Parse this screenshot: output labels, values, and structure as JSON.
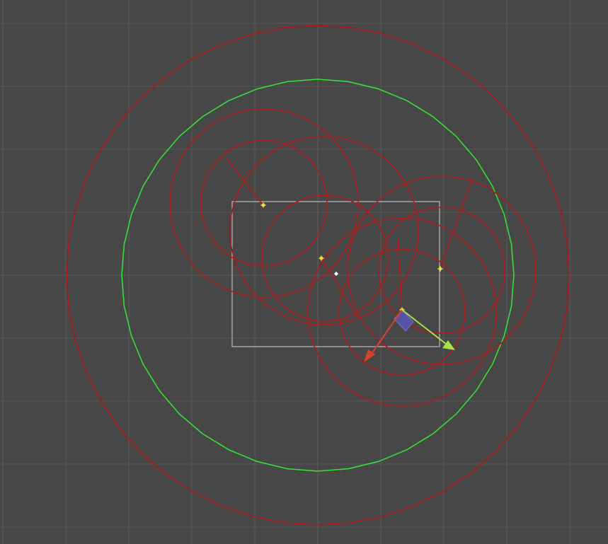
{
  "scene_view": {
    "background_color": "#474747",
    "grid_color": "#575757",
    "grid_axis_color": "#5e5e5e",
    "colors": {
      "outer_range": "#b31414",
      "inner_range": "#33e633",
      "light_ranges": "#b31818",
      "camera_frame": "#d0d0d0",
      "gizmo_x_axis": "#d9422a",
      "gizmo_z_axis": "#a6e34b",
      "gizmo_plane": "#5a5ac8",
      "light_icon": "#e8e04a",
      "pivot_icon": "#ffffff"
    },
    "icons": [
      "light-source-icon",
      "light-source-icon",
      "light-source-icon",
      "light-source-icon",
      "pivot-icon"
    ]
  }
}
